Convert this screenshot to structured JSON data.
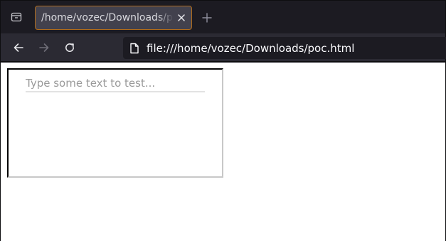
{
  "tab": {
    "title": "/home/vozec/Downloads/poc.html"
  },
  "toolbar": {
    "url": "file:///home/vozec/Downloads/poc.html"
  },
  "page": {
    "input_placeholder": "Type some text to test...",
    "input_value": ""
  },
  "icons": {
    "tab_list": "tab-list-icon",
    "close": "close-icon",
    "new_tab": "plus-icon",
    "back": "arrow-left-icon",
    "forward": "arrow-right-icon",
    "reload": "reload-icon",
    "page": "page-icon"
  },
  "colors": {
    "tab_active_border": "#b16c1b",
    "chrome_dark": "#1c1b22",
    "navbar": "#2b2a33",
    "content_bg": "#ffffff"
  }
}
